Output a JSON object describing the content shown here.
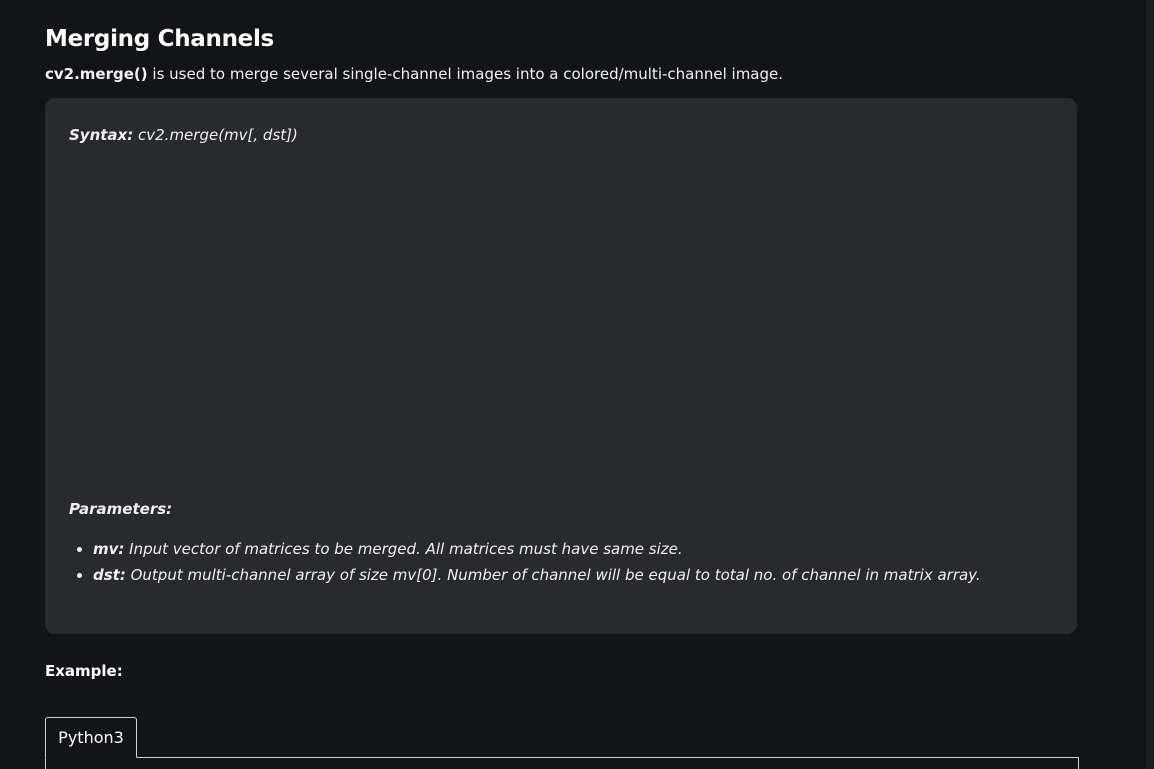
{
  "section": {
    "title": "Merging Channels",
    "intro_code": "cv2.merge()",
    "intro_text": " is used to merge several single-channel images into a colored/multi-channel image."
  },
  "syntax": {
    "label": "Syntax:",
    "signature": " cv2.merge(mv[, dst])"
  },
  "parameters": {
    "label": "Parameters:",
    "items": [
      {
        "name": "mv:",
        "desc": " Input vector of matrices to be merged. All matrices must have same size."
      },
      {
        "name": "dst:",
        "desc": " Output multi-channel array of size mv[0]. Number of channel will be equal to total no. of channel in matrix array."
      }
    ]
  },
  "example": {
    "label": "Example:",
    "tabs": [
      "Python3"
    ]
  },
  "colors": {
    "background": "#131417",
    "box": "#292a2d",
    "text": "#ffffff"
  }
}
